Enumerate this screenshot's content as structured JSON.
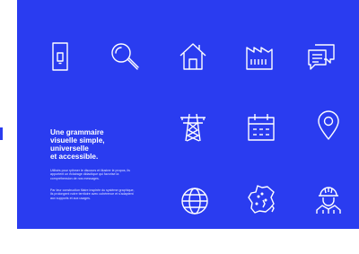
{
  "colors": {
    "panel_background": "#2a3cf0",
    "icon_stroke": "#ffffff",
    "text": "#ffffff"
  },
  "heading": {
    "line1": "Une grammaire",
    "line2": "visuelle simple,",
    "line3": "universelle",
    "line4": "et accessible."
  },
  "paragraph1": "Utilisés pour rythmer le discours et illustrer le propos, ils apportent un éclairage didactique qui favorise la compréhension de nos messages.",
  "paragraph2": "Par leur construction filaire inspirée du système graphique, ils prolongent notre territoire avec cohérence et s'adaptent aux supports et aux usages.",
  "icons": [
    "smart-meter-icon",
    "search-icon",
    "house-icon",
    "factory-icon",
    "chat-icon",
    "power-pylon-icon",
    "calendar-icon",
    "location-pin-icon",
    "globe-icon",
    "france-map-icon",
    "worker-icon"
  ]
}
